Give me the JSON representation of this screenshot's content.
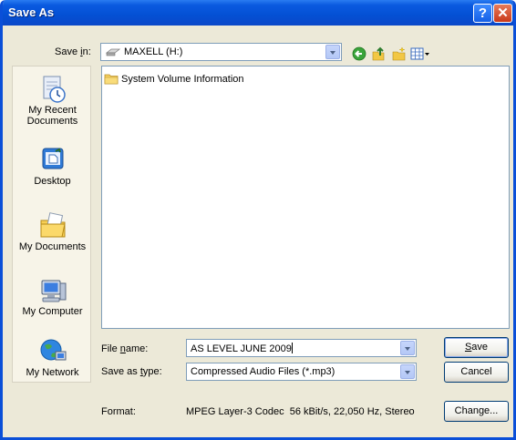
{
  "window": {
    "title": "Save As"
  },
  "save_in": {
    "label_pre": "Save ",
    "label_key": "i",
    "label_post": "n:",
    "value": "MAXELL (H:)"
  },
  "toolbar": {
    "back_icon": "back-arrow-icon",
    "up_icon": "up-folder-icon",
    "new_folder_icon": "new-folder-icon",
    "views_icon": "views-menu-icon"
  },
  "places": [
    {
      "name": "My Recent\nDocuments",
      "icon": "recent-documents-icon"
    },
    {
      "name": "Desktop",
      "icon": "desktop-icon"
    },
    {
      "name": "My Documents",
      "icon": "my-documents-icon"
    },
    {
      "name": "My Computer",
      "icon": "my-computer-icon"
    },
    {
      "name": "My Network",
      "icon": "my-network-icon"
    }
  ],
  "files": [
    {
      "name": "System Volume Information",
      "type": "folder"
    }
  ],
  "file_name": {
    "label_pre": "File ",
    "label_key": "n",
    "label_post": "ame:",
    "value": "AS LEVEL JUNE 2009"
  },
  "save_as_type": {
    "label_pre": "Save as ",
    "label_key": "t",
    "label_post": "ype:",
    "value": "Compressed Audio Files (*.mp3)"
  },
  "format": {
    "label": "Format:",
    "value": "MPEG Layer-3 Codec  56 kBit/s, 22,050 Hz, Stereo"
  },
  "buttons": {
    "save_key": "S",
    "save_rest": "ave",
    "cancel": "Cancel",
    "change": "Change..."
  },
  "colors": {
    "titlebar": "#0a5ae0",
    "dialog_bg": "#ece9d8",
    "places_bg": "#f7f4e8"
  }
}
